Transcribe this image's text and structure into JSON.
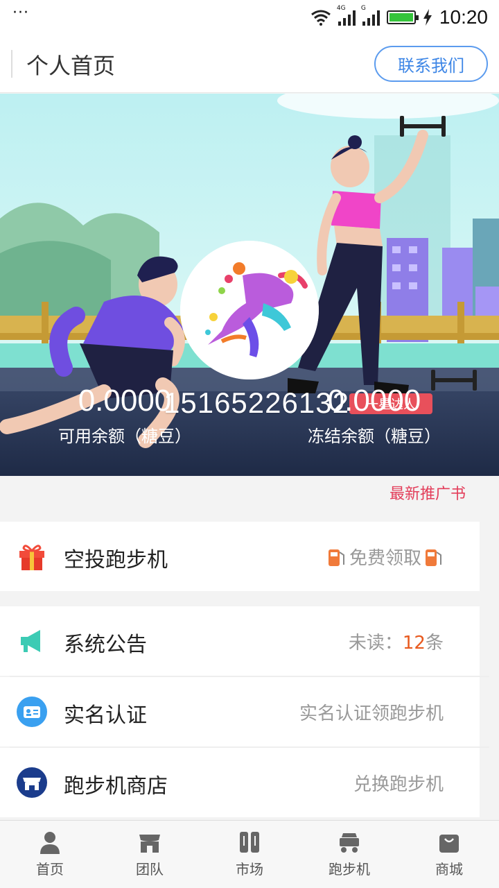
{
  "status_bar": {
    "time": "10:20",
    "signal1_tag": "4G",
    "signal2_tag": "G"
  },
  "header": {
    "title": "个人首页",
    "contact_label": "联系我们"
  },
  "profile": {
    "phone": "15165226132",
    "level_badge": "一星达人"
  },
  "balances": [
    {
      "value": "0.0000",
      "label": "可用余额（糖豆）"
    },
    {
      "value": "0.0000",
      "label": "冻结余额（糖豆）"
    }
  ],
  "promo_link": "最新推广书",
  "airdrop": {
    "label": "空投跑步机",
    "extra": "免费领取"
  },
  "menu": [
    {
      "label": "系统公告",
      "extra_prefix": "未读：",
      "extra_count": "12",
      "extra_suffix": "条"
    },
    {
      "label": "实名认证",
      "extra": "实名认证领跑步机"
    },
    {
      "label": "跑步机商店",
      "extra": "兑换跑步机"
    }
  ],
  "nav": [
    {
      "label": "首页",
      "icon": "person-icon"
    },
    {
      "label": "团队",
      "icon": "store-icon"
    },
    {
      "label": "市场",
      "icon": "market-icon"
    },
    {
      "label": "跑步机",
      "icon": "cart-icon"
    },
    {
      "label": "商城",
      "icon": "bag-icon"
    }
  ],
  "colors": {
    "accent_blue": "#3d86e6",
    "promo_red": "#e33d5a",
    "badge_red": "#e8505b",
    "count_orange": "#e85a1f"
  }
}
